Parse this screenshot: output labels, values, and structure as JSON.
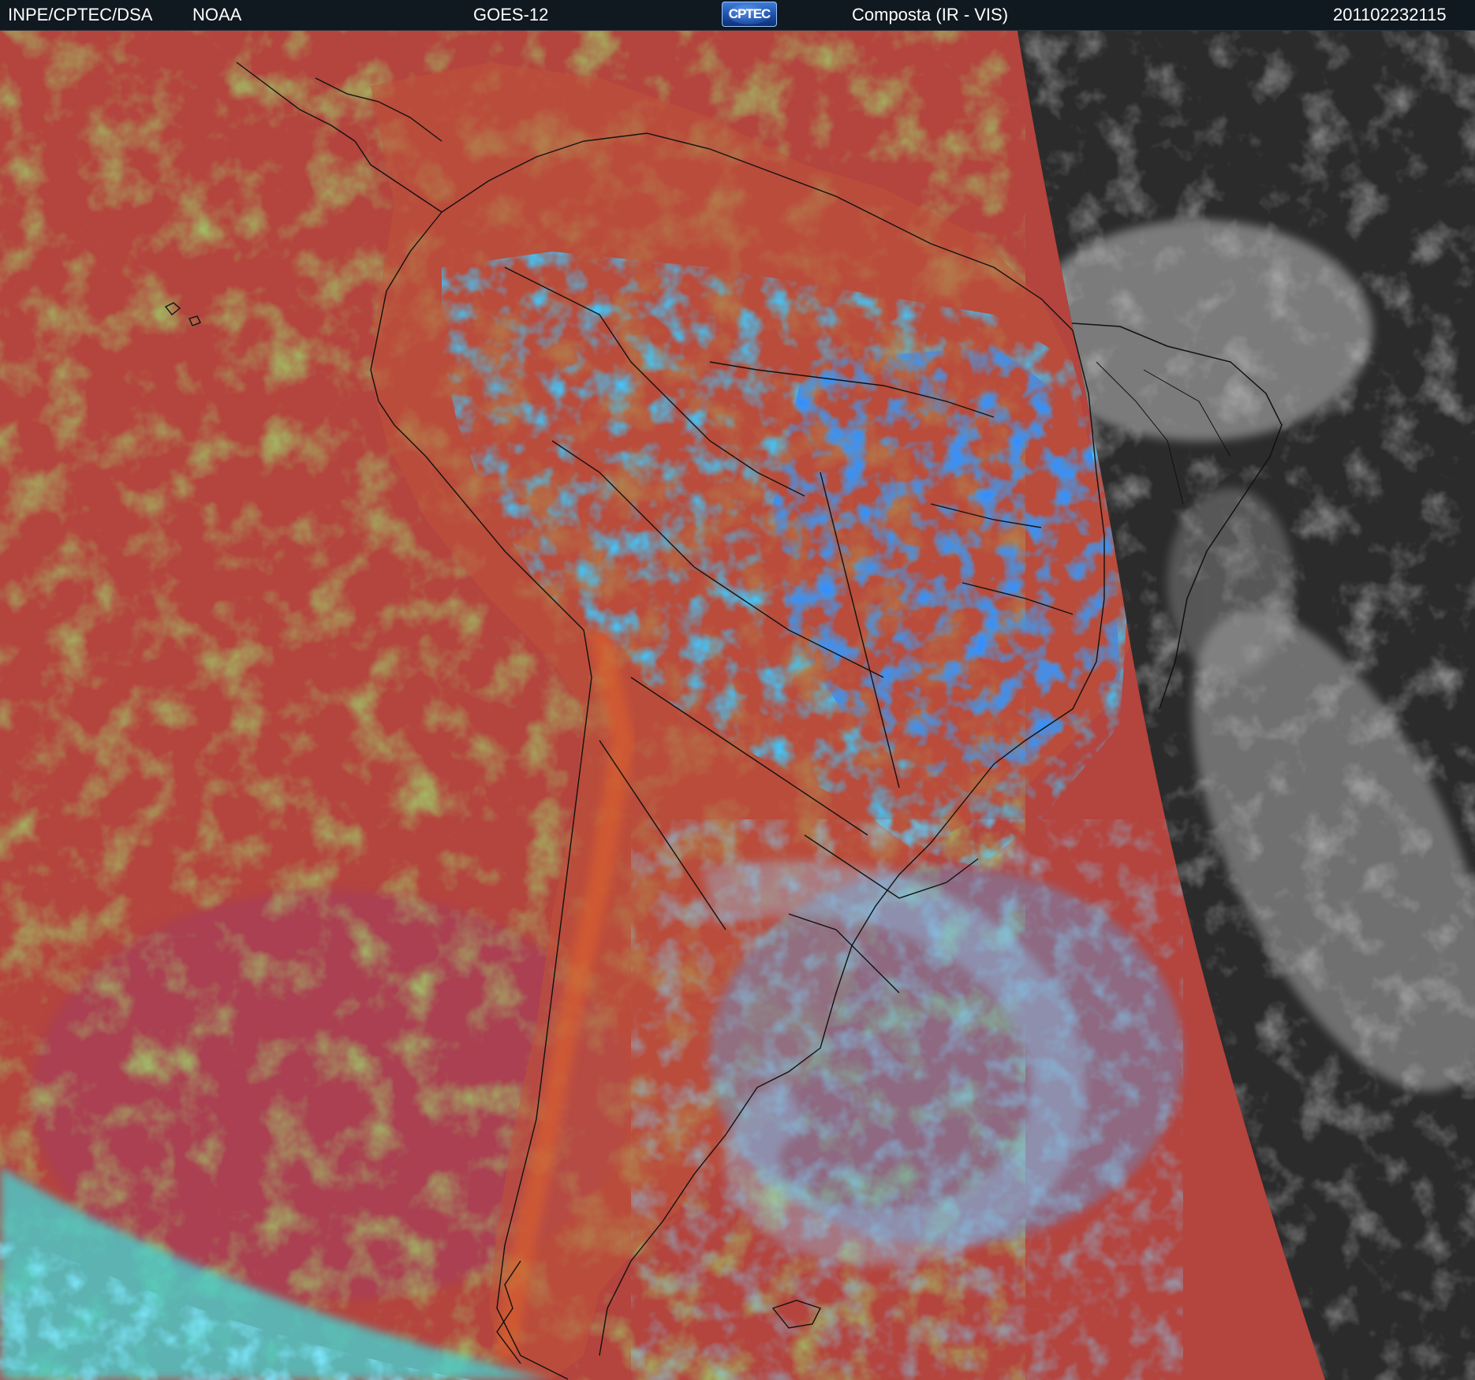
{
  "header": {
    "agency": "INPE/CPTEC/DSA",
    "source": "NOAA",
    "satellite": "GOES-12",
    "logo_text": "CPTEC",
    "product": "Composta (IR - VIS)",
    "timestamp": "201102232115"
  },
  "colors": {
    "ocean_ir": "#b4443e",
    "low_cloud": "#9fd36c",
    "high_cloud": "#3fc8ff",
    "very_high_cloud": "#2f7dff",
    "night_vis_bg": "#2b2b2b",
    "coastline": "#111111"
  },
  "icons": {
    "logo": "cptec-globe-logo"
  }
}
